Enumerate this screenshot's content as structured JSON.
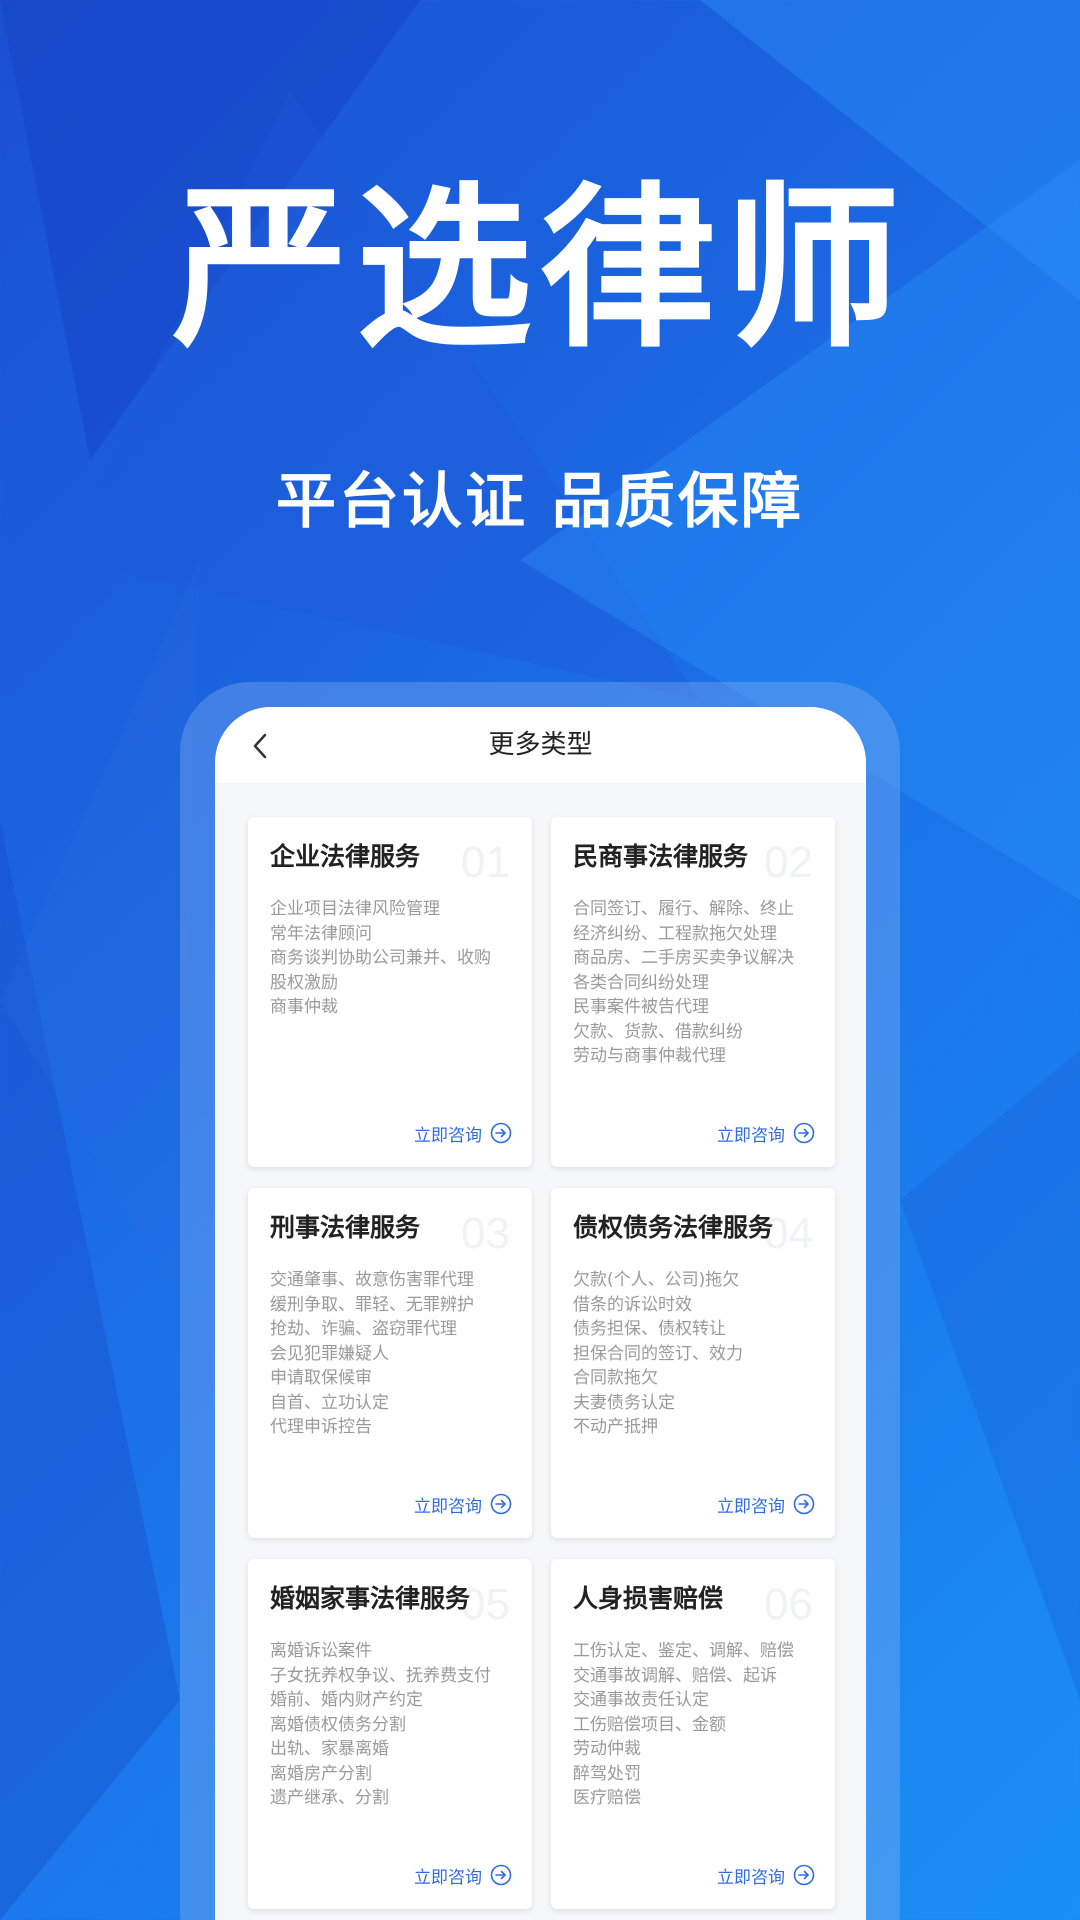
{
  "colors": {
    "background_start": "#1a4fd0",
    "background_end": "#1a8ff5",
    "accent": "#2e6be6",
    "card_text": "#9a9a9a",
    "title_text": "#222222"
  },
  "hero": {
    "title": "严选律师",
    "subtitle": "平台认证 品质保障"
  },
  "topbar": {
    "back_icon": "chevron-left-icon",
    "title": "更多类型"
  },
  "cards": [
    {
      "title": "企业法律服务",
      "number": "01",
      "items": [
        "企业项目法律风险管理",
        "常年法律顾问",
        "商务谈判协助公司兼并、收购",
        "股权激励",
        "商事仲裁"
      ],
      "action": "立即咨询",
      "action_icon": "arrow-right-circle-icon"
    },
    {
      "title": "民商事法律服务",
      "number": "02",
      "items": [
        "合同签订、履行、解除、终止",
        "经济纠纷、工程款拖欠处理",
        "商品房、二手房买卖争议解决",
        "各类合同纠纷处理",
        "民事案件被告代理",
        "欠款、货款、借款纠纷",
        "劳动与商事仲裁代理"
      ],
      "action": "立即咨询",
      "action_icon": "arrow-right-circle-icon"
    },
    {
      "title": "刑事法律服务",
      "number": "03",
      "items": [
        "交通肇事、故意伤害罪代理",
        "缓刑争取、罪轻、无罪辨护",
        "抢劫、诈骗、盗窃罪代理",
        "会见犯罪嫌疑人",
        "申请取保候审",
        "自首、立功认定",
        "代理申诉控告"
      ],
      "action": "立即咨询",
      "action_icon": "arrow-right-circle-icon"
    },
    {
      "title": "债权债务法律服务",
      "number": "04",
      "items": [
        "欠款(个人、公司)拖欠",
        "借条的诉讼时效",
        "债务担保、债权转让",
        "担保合同的签订、效力",
        "合同款拖欠",
        "夫妻债务认定",
        "不动产抵押"
      ],
      "action": "立即咨询",
      "action_icon": "arrow-right-circle-icon"
    },
    {
      "title": "婚姻家事法律服务",
      "number": "05",
      "items": [
        "离婚诉讼案件",
        "子女抚养权争议、抚养费支付",
        "婚前、婚内财产约定",
        "离婚债权债务分割",
        "出轨、家暴离婚",
        "离婚房产分割",
        "遗产继承、分割"
      ],
      "action": "立即咨询",
      "action_icon": "arrow-right-circle-icon"
    },
    {
      "title": "人身损害赔偿",
      "number": "06",
      "items": [
        "工伤认定、鉴定、调解、赔偿",
        "交通事故调解、赔偿、起诉",
        "交通事故责任认定",
        "工伤赔偿项目、金额",
        "劳动仲裁",
        "醉驾处罚",
        "医疗赔偿"
      ],
      "action": "立即咨询",
      "action_icon": "arrow-right-circle-icon"
    }
  ]
}
